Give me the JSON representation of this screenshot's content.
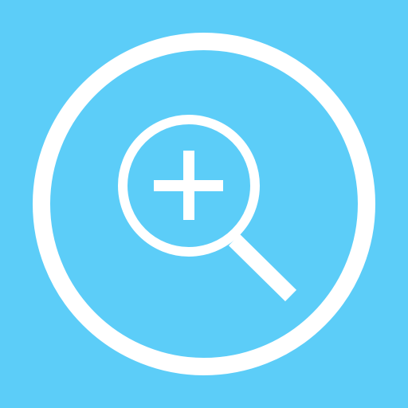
{
  "app": {
    "background_color": "#5ccdf8",
    "foreground_color": "#ffffff",
    "icon": "zoom-in-icon"
  },
  "icon_parts": {
    "outer_ring": "outer-circle-ring",
    "lens": "magnifier-lens",
    "handle": "magnifier-handle",
    "symbol": "plus-symbol"
  }
}
